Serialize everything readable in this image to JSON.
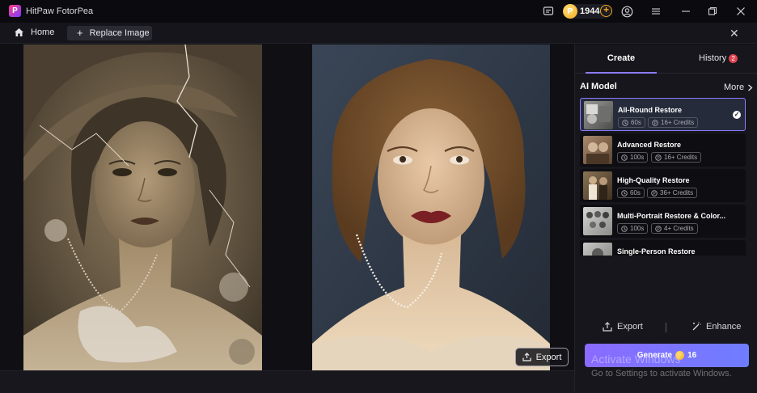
{
  "window": {
    "app_title": "HitPaw FotorPea",
    "logo_letter": "P"
  },
  "titlebar": {
    "credits": "1944",
    "icons": [
      "feedback-icon",
      "add-credits-icon",
      "user-icon",
      "menu-icon",
      "minimize-icon",
      "maximize-icon",
      "close-icon"
    ]
  },
  "tabbar": {
    "home_label": "Home",
    "replace_label": "Replace Image"
  },
  "canvas": {
    "export_label": "Export"
  },
  "panel": {
    "tab_create": "Create",
    "tab_history": "History",
    "history_badge": "2",
    "section_title": "AI Model",
    "more_label": "More",
    "models": [
      {
        "name": "All-Round Restore",
        "time": "60s",
        "credits": "16+ Credits",
        "selected": true
      },
      {
        "name": "Advanced Restore",
        "time": "100s",
        "credits": "16+ Credits",
        "selected": false
      },
      {
        "name": "High-Quality Restore",
        "time": "60s",
        "credits": "36+ Credits",
        "selected": false
      },
      {
        "name": "Multi-Portrait Restore & Color...",
        "time": "100s",
        "credits": "4+ Credits",
        "selected": false
      },
      {
        "name": "Single-Person Restore",
        "time": "",
        "credits": "",
        "selected": false
      }
    ],
    "export_label": "Export",
    "enhance_label": "Enhance",
    "generate_label": "Generate",
    "generate_cost": "16"
  },
  "os_watermark": {
    "line1": "Activate Windows",
    "line2": "Go to Settings to activate Windows."
  },
  "colors": {
    "accent": "#8b7bff",
    "badge": "#e0424f",
    "coin": "#f2a81c"
  }
}
